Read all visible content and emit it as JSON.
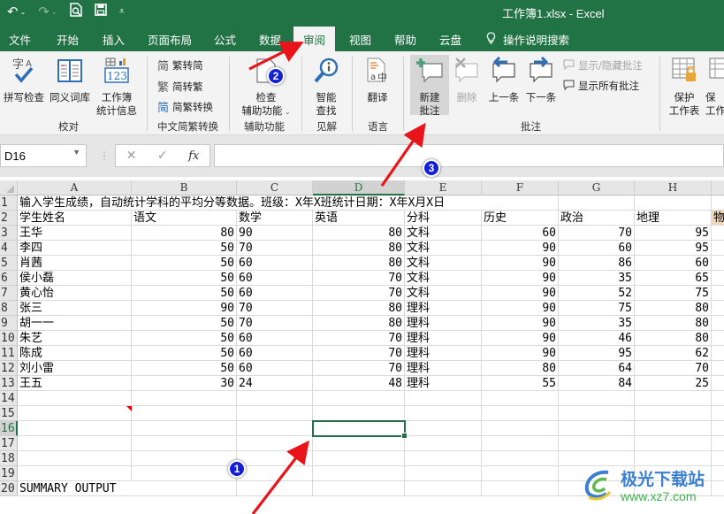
{
  "window": {
    "title": "工作簿1.xlsx  -  Excel",
    "qat": {
      "undo": "↶",
      "redo": "↷",
      "print_preview": "🗋",
      "save": "💾",
      "customize": "⩡"
    }
  },
  "tabs": [
    {
      "label": "文件"
    },
    {
      "label": "开始"
    },
    {
      "label": "插入"
    },
    {
      "label": "页面布局"
    },
    {
      "label": "公式"
    },
    {
      "label": "数据"
    },
    {
      "label": "审阅",
      "active": true
    },
    {
      "label": "视图"
    },
    {
      "label": "帮助"
    },
    {
      "label": "云盘"
    },
    {
      "label": "操作说明搜索"
    }
  ],
  "ribbon": {
    "groups": {
      "proofing": {
        "label": "校对",
        "spell_check": "拼写检查",
        "thesaurus": "同义词库",
        "workbook_stats_1": "工作簿",
        "workbook_stats_2": "统计信息"
      },
      "chinese_conversion": {
        "label": "中文简繁转换",
        "to_simplified": "繁转简",
        "to_traditional": "简转繁",
        "convert": "简繁转换"
      },
      "accessibility": {
        "label": "辅助功能",
        "check_1": "检查",
        "check_2": "辅助功能"
      },
      "insights": {
        "label": "见解",
        "smart_lookup_1": "智能",
        "smart_lookup_2": "查找"
      },
      "language": {
        "label": "语言",
        "translate": "翻译"
      },
      "comments": {
        "label": "批注",
        "new_comment_1": "新建",
        "new_comment_2": "批注",
        "delete": "删除",
        "previous": "上一条",
        "next": "下一条",
        "show_hide": "显示/隐藏批注",
        "show_all": "显示所有批注"
      },
      "protect": {
        "protect_sheet_1": "保护",
        "protect_sheet_2": "工作表",
        "protect_workbook_1": "保",
        "protect_workbook_2": "工作"
      }
    }
  },
  "formula_bar": {
    "name_box": "D16",
    "cancel": "✕",
    "enter": "✓",
    "fx": "fx",
    "formula": ""
  },
  "sheet": {
    "columns": [
      "A",
      "B",
      "C",
      "D",
      "E",
      "F",
      "G",
      "H"
    ],
    "selected_cell": "D16",
    "rows": [
      {
        "n": "1",
        "cells": [
          "输入学生成绩，自动统计学科的平均分等数据。班级：X年X班统计日期：X年X月X日",
          "",
          "",
          "",
          "",
          "",
          "",
          ""
        ]
      },
      {
        "n": "2",
        "cells": [
          "学生姓名",
          "语文",
          "数学",
          "英语",
          "分科",
          "历史",
          "政治",
          "地理"
        ],
        "extra": "物"
      },
      {
        "n": "3",
        "cells": [
          "王华",
          "80",
          "90",
          "80",
          "文科",
          "60",
          "70",
          "95"
        ]
      },
      {
        "n": "4",
        "cells": [
          "李四",
          "50",
          "70",
          "80",
          "文科",
          "90",
          "60",
          "95"
        ]
      },
      {
        "n": "5",
        "cells": [
          "肖茜",
          "50",
          "60",
          "80",
          "文科",
          "90",
          "86",
          "60"
        ]
      },
      {
        "n": "6",
        "cells": [
          "侯小磊",
          "50",
          "60",
          "70",
          "文科",
          "90",
          "35",
          "65"
        ]
      },
      {
        "n": "7",
        "cells": [
          "黄心怡",
          "50",
          "60",
          "70",
          "文科",
          "90",
          "52",
          "75"
        ]
      },
      {
        "n": "8",
        "cells": [
          "张三",
          "90",
          "70",
          "80",
          "理科",
          "90",
          "75",
          "80"
        ]
      },
      {
        "n": "9",
        "cells": [
          "胡一一",
          "50",
          "70",
          "80",
          "理科",
          "90",
          "35",
          "80"
        ]
      },
      {
        "n": "10",
        "cells": [
          "朱艺",
          "50",
          "60",
          "70",
          "理科",
          "90",
          "46",
          "80"
        ]
      },
      {
        "n": "11",
        "cells": [
          "陈成",
          "50",
          "60",
          "70",
          "理科",
          "90",
          "95",
          "62"
        ]
      },
      {
        "n": "12",
        "cells": [
          "刘小雷",
          "50",
          "60",
          "70",
          "理科",
          "80",
          "64",
          "70"
        ]
      },
      {
        "n": "13",
        "cells": [
          "王五",
          "30",
          "24",
          "48",
          "理科",
          "55",
          "84",
          "25"
        ]
      },
      {
        "n": "14",
        "cells": [
          "",
          "",
          "",
          "",
          "",
          "",
          "",
          ""
        ]
      },
      {
        "n": "15",
        "cells": [
          "",
          "",
          "",
          "",
          "",
          "",
          "",
          ""
        ]
      },
      {
        "n": "16",
        "cells": [
          "",
          "",
          "",
          "",
          "",
          "",
          "",
          ""
        ]
      },
      {
        "n": "17",
        "cells": [
          "",
          "",
          "",
          "",
          "",
          "",
          "",
          ""
        ]
      },
      {
        "n": "18",
        "cells": [
          "",
          "",
          "",
          "",
          "",
          "",
          "",
          ""
        ]
      },
      {
        "n": "19",
        "cells": [
          "",
          "",
          "",
          "",
          "",
          "",
          "",
          ""
        ]
      },
      {
        "n": "20",
        "cells": [
          "SUMMARY OUTPUT",
          "",
          "",
          "",
          "",
          "",
          "",
          ""
        ]
      }
    ]
  },
  "annotations": {
    "step1": "1",
    "step2": "2",
    "step3": "3",
    "arrow_color": "#e8141a",
    "badge_color": "#1320d8"
  },
  "watermark": {
    "name": "极光下载站",
    "url": "www.xz7.com"
  },
  "colors": {
    "excel_green": "#217346",
    "ribbon_bg": "#f3f3f3"
  }
}
